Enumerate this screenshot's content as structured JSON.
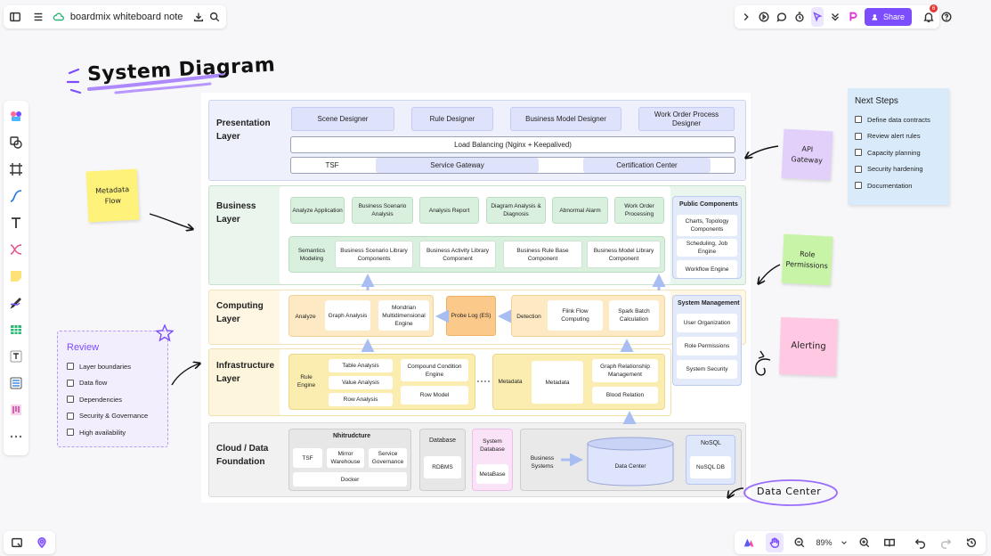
{
  "app": {
    "doc_title": "boardmix whiteboard note"
  },
  "toolbar_right": {
    "share_label": "Share",
    "notification_count": "6"
  },
  "zoom": {
    "level": "89%"
  },
  "heading": "System Diagram",
  "presentation": {
    "label": "Presentation\nLayer",
    "designers": [
      "Scene Designer",
      "Rule Designer",
      "Business Model Designer",
      "Work Order Process Designer"
    ],
    "load_balancing": "Load Balancing (Nginx + Keepalived)",
    "tsf": "TSF",
    "service_gateway": "Service Gateway",
    "cert_center": "Certification Center"
  },
  "business": {
    "label": "Business\nLayer",
    "top_row": [
      "Analyze Application",
      "Business Scenario Analysis",
      "Analysis Report",
      "Diagram Analysis & Diagnosis",
      "Abnormal Alarm",
      "Work Order Processing"
    ],
    "bottom_row": [
      "Semantics Modeling",
      "Business Scenario Library Components",
      "Business Activity Library Component",
      "Business Rule Base Component",
      "Business Model Library Component"
    ],
    "public_title": "Public Components",
    "public_items": [
      "Charts, Topology Components",
      "Scheduling, Job Engine",
      "Workflow Engine"
    ]
  },
  "computing": {
    "label": "Computing\nLayer",
    "analyze": "Analyze",
    "graph_analysis": "Graph Analysis",
    "mondrian": "Mondrian Multidimensional Engine",
    "probe_log": "Probe Log (ES)",
    "detection": "Detection",
    "flink": "Flink Flow Computing",
    "spark": "Spark Batch Calculation",
    "sysmgmt_title": "System Management",
    "sysmgmt_items": [
      "User Organization",
      "Role Permissions",
      "System Security"
    ]
  },
  "infrastructure": {
    "label": "Infrastructure\nLayer",
    "rule_engine": "Rule Engine",
    "table_analysis": "Table Analysis",
    "value_analysis": "Value Analysis",
    "row_analysis": "Row Analysis",
    "compound": "Compound Condition Engine",
    "row_model": "Row Model",
    "metadata_label": "Metadata",
    "metadata_box": "Metadata",
    "graph_rel": "Graph Relationship Management",
    "blood_rel": "Blood Relation"
  },
  "cloud": {
    "label": "Cloud / Data\nFoundation",
    "infra_title": "Nhitrudcture",
    "tsf": "TSF",
    "mirror": "Mirror Warehouse",
    "governance": "Service Governance",
    "docker": "Docker",
    "db_title": "Database",
    "rdbms": "RDBMS",
    "sysdb_title": "System Database",
    "metabase": "MetaBase",
    "business_systems": "Business Systems",
    "data_center": "Data Center",
    "nosql_title": "NoSQL",
    "nosql_db": "NoSQL DB"
  },
  "notes": {
    "metadata_flow": "Metadata\nFlow",
    "api_gateway": "API\nGateway",
    "role_permissions": "Role\nPermissions",
    "alerting": "Alerting",
    "data_center_tag": "Data Center"
  },
  "review": {
    "title": "Review",
    "items": [
      "Layer boundaries",
      "Data flow",
      "Dependencies",
      "Security & Governance",
      "High availability"
    ]
  },
  "next_steps": {
    "title": "Next Steps",
    "items": [
      "Define data contracts",
      "Review alert rules",
      "Capacity planning",
      "Security hardening",
      "Documentation"
    ]
  },
  "colors": {
    "accent": "#7b4dff",
    "presentation_bg": "#eef1fb",
    "business_bg": "#eaf5ee",
    "computing_bg": "#fff6e4",
    "infra_bg": "#fdf6dc",
    "cloud_bg": "#f1f1f1"
  }
}
